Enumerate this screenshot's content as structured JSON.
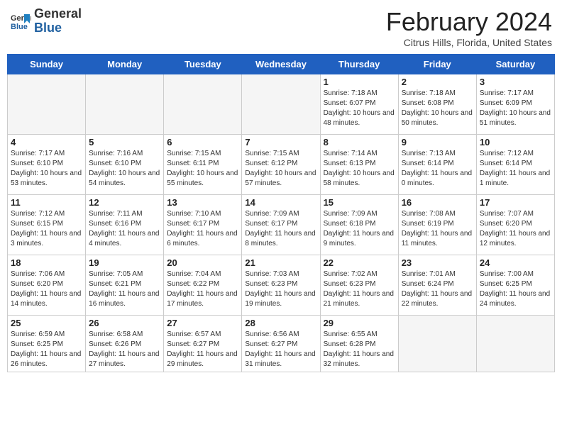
{
  "title": "February 2024",
  "subtitle": "Citrus Hills, Florida, United States",
  "logo": {
    "general": "General",
    "blue": "Blue"
  },
  "days_of_week": [
    "Sunday",
    "Monday",
    "Tuesday",
    "Wednesday",
    "Thursday",
    "Friday",
    "Saturday"
  ],
  "weeks": [
    [
      {
        "day": "",
        "info": ""
      },
      {
        "day": "",
        "info": ""
      },
      {
        "day": "",
        "info": ""
      },
      {
        "day": "",
        "info": ""
      },
      {
        "day": "1",
        "info": "Sunrise: 7:18 AM\nSunset: 6:07 PM\nDaylight: 10 hours and 48 minutes."
      },
      {
        "day": "2",
        "info": "Sunrise: 7:18 AM\nSunset: 6:08 PM\nDaylight: 10 hours and 50 minutes."
      },
      {
        "day": "3",
        "info": "Sunrise: 7:17 AM\nSunset: 6:09 PM\nDaylight: 10 hours and 51 minutes."
      }
    ],
    [
      {
        "day": "4",
        "info": "Sunrise: 7:17 AM\nSunset: 6:10 PM\nDaylight: 10 hours and 53 minutes."
      },
      {
        "day": "5",
        "info": "Sunrise: 7:16 AM\nSunset: 6:10 PM\nDaylight: 10 hours and 54 minutes."
      },
      {
        "day": "6",
        "info": "Sunrise: 7:15 AM\nSunset: 6:11 PM\nDaylight: 10 hours and 55 minutes."
      },
      {
        "day": "7",
        "info": "Sunrise: 7:15 AM\nSunset: 6:12 PM\nDaylight: 10 hours and 57 minutes."
      },
      {
        "day": "8",
        "info": "Sunrise: 7:14 AM\nSunset: 6:13 PM\nDaylight: 10 hours and 58 minutes."
      },
      {
        "day": "9",
        "info": "Sunrise: 7:13 AM\nSunset: 6:14 PM\nDaylight: 11 hours and 0 minutes."
      },
      {
        "day": "10",
        "info": "Sunrise: 7:12 AM\nSunset: 6:14 PM\nDaylight: 11 hours and 1 minute."
      }
    ],
    [
      {
        "day": "11",
        "info": "Sunrise: 7:12 AM\nSunset: 6:15 PM\nDaylight: 11 hours and 3 minutes."
      },
      {
        "day": "12",
        "info": "Sunrise: 7:11 AM\nSunset: 6:16 PM\nDaylight: 11 hours and 4 minutes."
      },
      {
        "day": "13",
        "info": "Sunrise: 7:10 AM\nSunset: 6:17 PM\nDaylight: 11 hours and 6 minutes."
      },
      {
        "day": "14",
        "info": "Sunrise: 7:09 AM\nSunset: 6:17 PM\nDaylight: 11 hours and 8 minutes."
      },
      {
        "day": "15",
        "info": "Sunrise: 7:09 AM\nSunset: 6:18 PM\nDaylight: 11 hours and 9 minutes."
      },
      {
        "day": "16",
        "info": "Sunrise: 7:08 AM\nSunset: 6:19 PM\nDaylight: 11 hours and 11 minutes."
      },
      {
        "day": "17",
        "info": "Sunrise: 7:07 AM\nSunset: 6:20 PM\nDaylight: 11 hours and 12 minutes."
      }
    ],
    [
      {
        "day": "18",
        "info": "Sunrise: 7:06 AM\nSunset: 6:20 PM\nDaylight: 11 hours and 14 minutes."
      },
      {
        "day": "19",
        "info": "Sunrise: 7:05 AM\nSunset: 6:21 PM\nDaylight: 11 hours and 16 minutes."
      },
      {
        "day": "20",
        "info": "Sunrise: 7:04 AM\nSunset: 6:22 PM\nDaylight: 11 hours and 17 minutes."
      },
      {
        "day": "21",
        "info": "Sunrise: 7:03 AM\nSunset: 6:23 PM\nDaylight: 11 hours and 19 minutes."
      },
      {
        "day": "22",
        "info": "Sunrise: 7:02 AM\nSunset: 6:23 PM\nDaylight: 11 hours and 21 minutes."
      },
      {
        "day": "23",
        "info": "Sunrise: 7:01 AM\nSunset: 6:24 PM\nDaylight: 11 hours and 22 minutes."
      },
      {
        "day": "24",
        "info": "Sunrise: 7:00 AM\nSunset: 6:25 PM\nDaylight: 11 hours and 24 minutes."
      }
    ],
    [
      {
        "day": "25",
        "info": "Sunrise: 6:59 AM\nSunset: 6:25 PM\nDaylight: 11 hours and 26 minutes."
      },
      {
        "day": "26",
        "info": "Sunrise: 6:58 AM\nSunset: 6:26 PM\nDaylight: 11 hours and 27 minutes."
      },
      {
        "day": "27",
        "info": "Sunrise: 6:57 AM\nSunset: 6:27 PM\nDaylight: 11 hours and 29 minutes."
      },
      {
        "day": "28",
        "info": "Sunrise: 6:56 AM\nSunset: 6:27 PM\nDaylight: 11 hours and 31 minutes."
      },
      {
        "day": "29",
        "info": "Sunrise: 6:55 AM\nSunset: 6:28 PM\nDaylight: 11 hours and 32 minutes."
      },
      {
        "day": "",
        "info": ""
      },
      {
        "day": "",
        "info": ""
      }
    ]
  ]
}
